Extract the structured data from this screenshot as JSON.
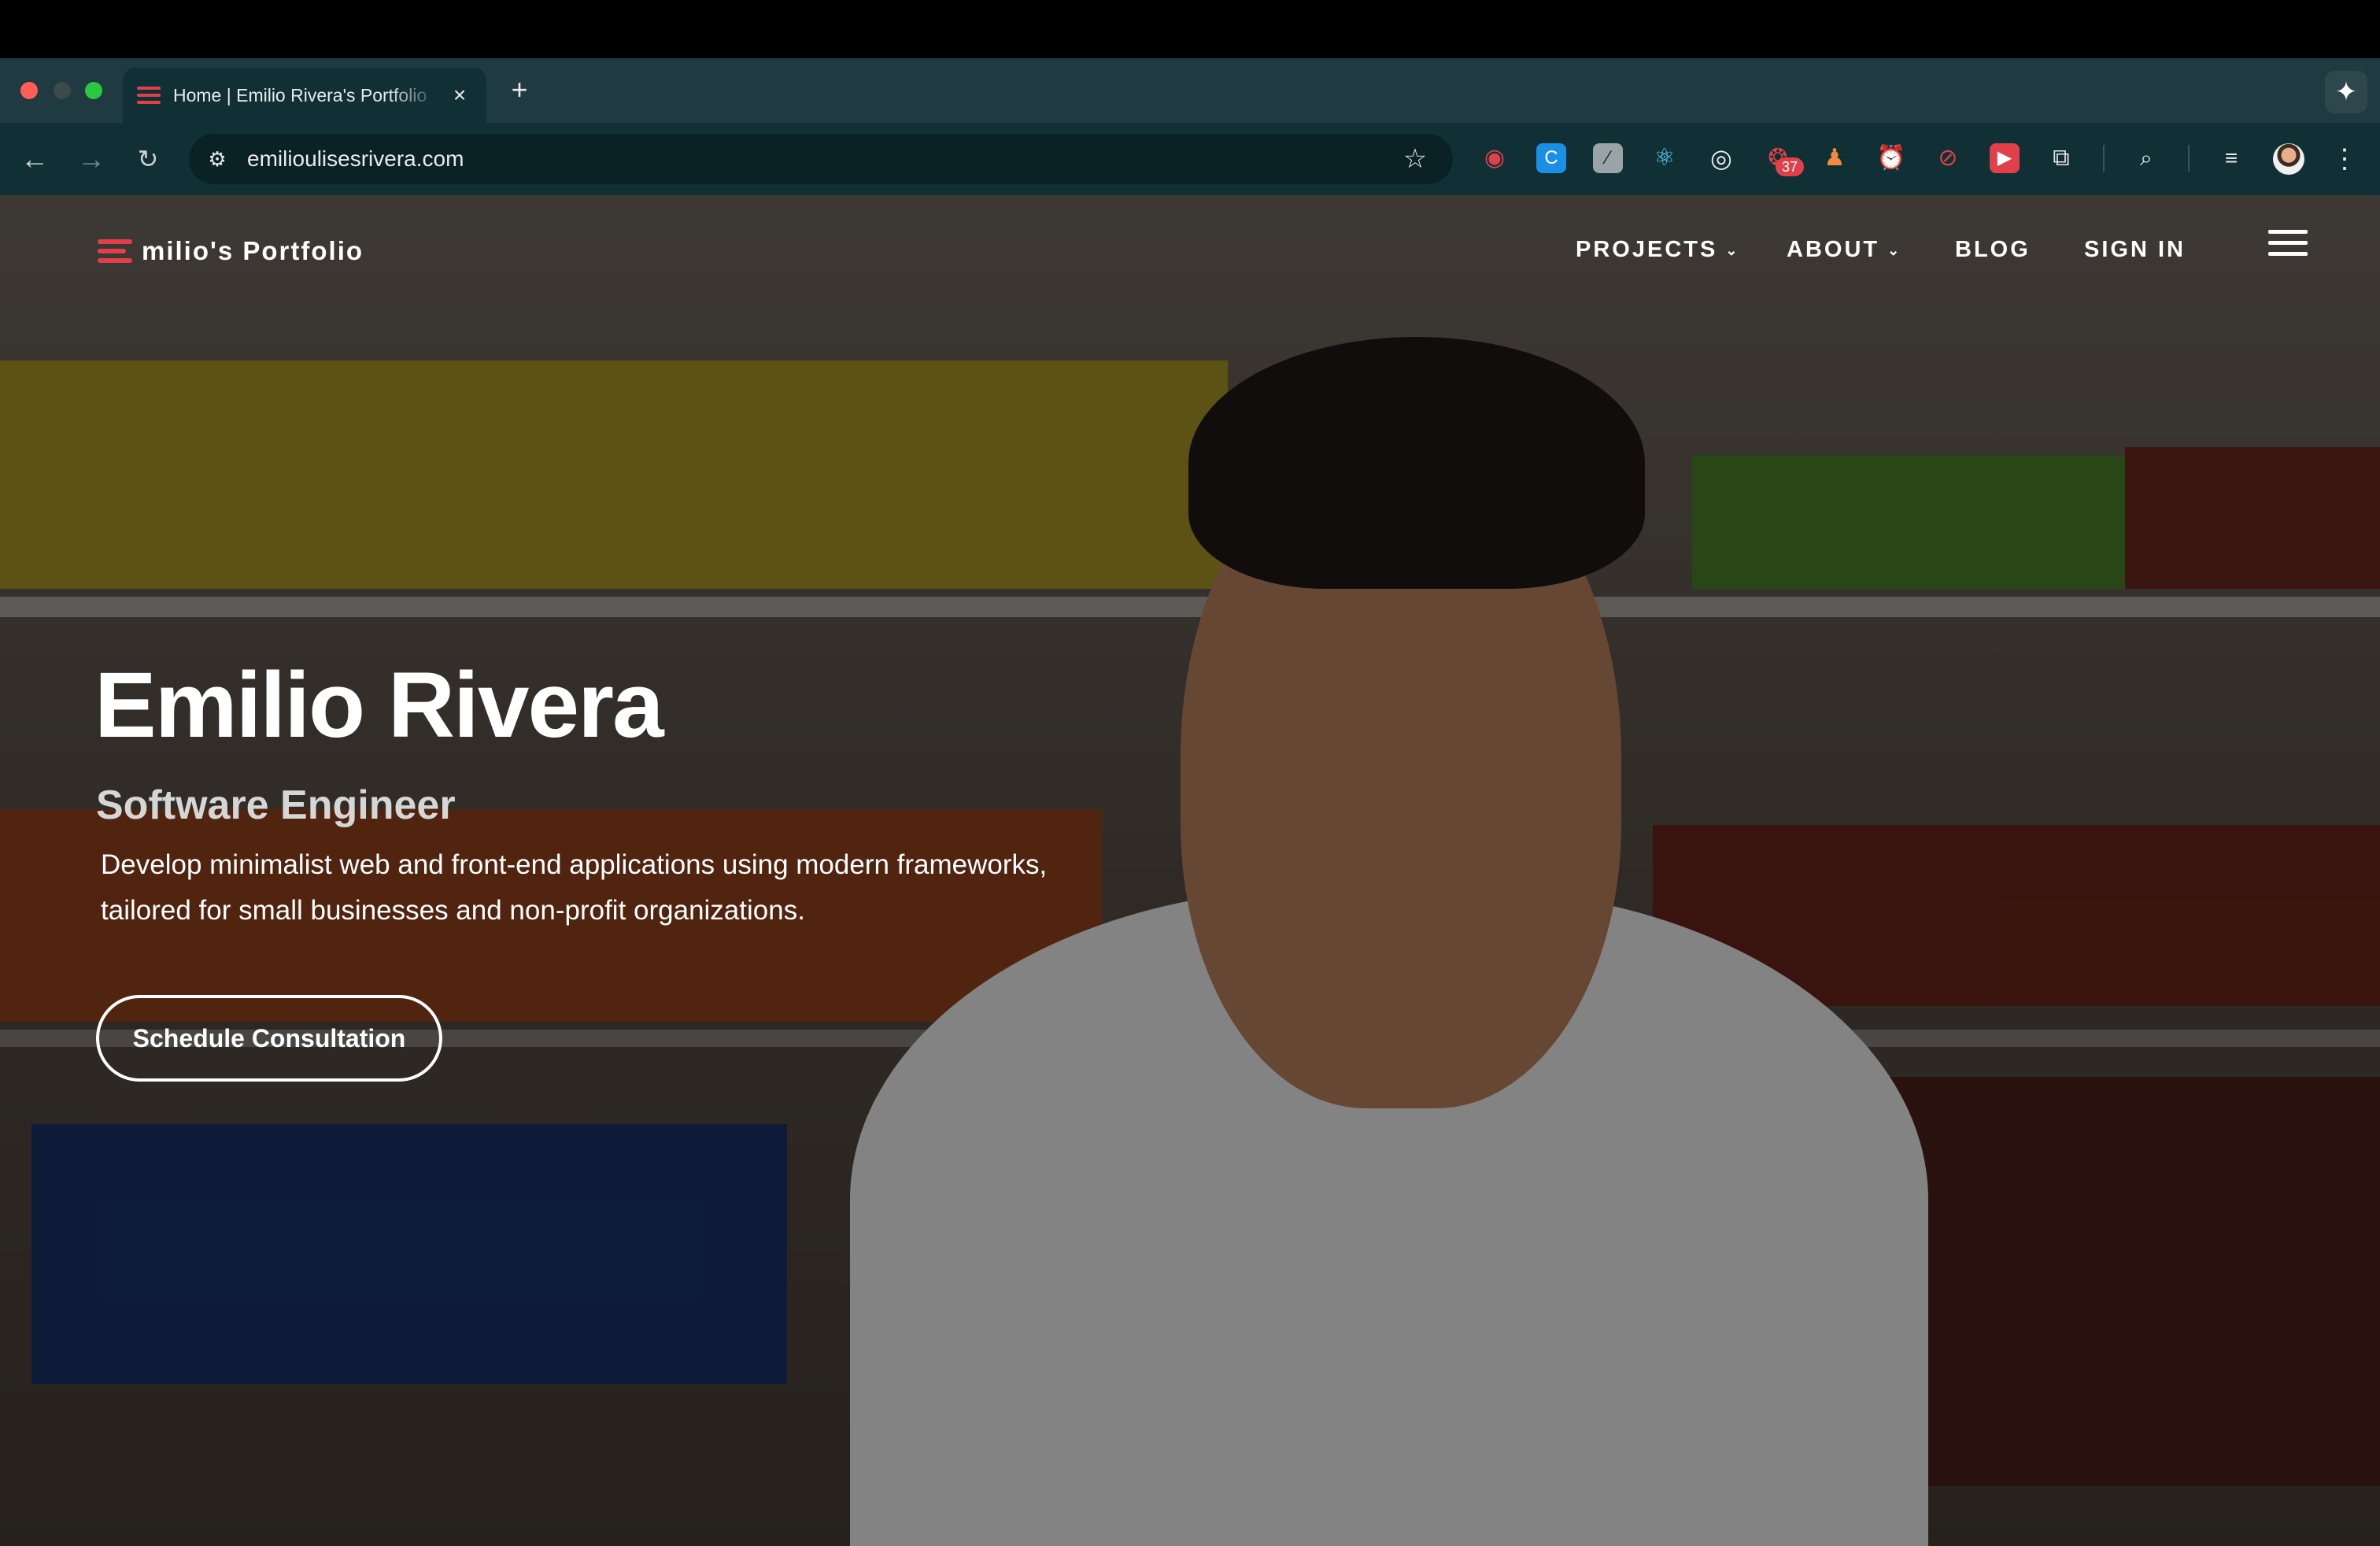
{
  "browser": {
    "tab_title": "Home | Emilio Rivera's Portfolio",
    "tab_close": "×",
    "new_tab": "+",
    "url": "emilioulisesrivera.com",
    "extension_badge_count": "37",
    "icons": [
      "back-icon",
      "forward-icon",
      "reload-icon",
      "site-info-icon",
      "bookmark-star-icon",
      "gemini-icon",
      "extensions-puzzle-icon",
      "reading-list-icon",
      "tab-search-icon",
      "profile-avatar-icon",
      "more-menu-icon"
    ]
  },
  "site": {
    "brand": "milio's Portfolio",
    "nav": {
      "projects": "PROJECTS",
      "about": "ABOUT",
      "blog": "BLOG",
      "sign_in": "SIGN IN"
    },
    "caret": "⌄"
  },
  "hero": {
    "name": "Emilio Rivera",
    "role": "Software Engineer",
    "description": "Develop minimalist web and front-end applications using modern frameworks, tailored for small businesses and non-profit organizations.",
    "cta": "Schedule Consultation"
  },
  "colors": {
    "accent_red": "#e0404a",
    "chrome_dark": "#103035",
    "text_white": "#ffffff",
    "subtitle_gray": "#d6d6d6"
  }
}
